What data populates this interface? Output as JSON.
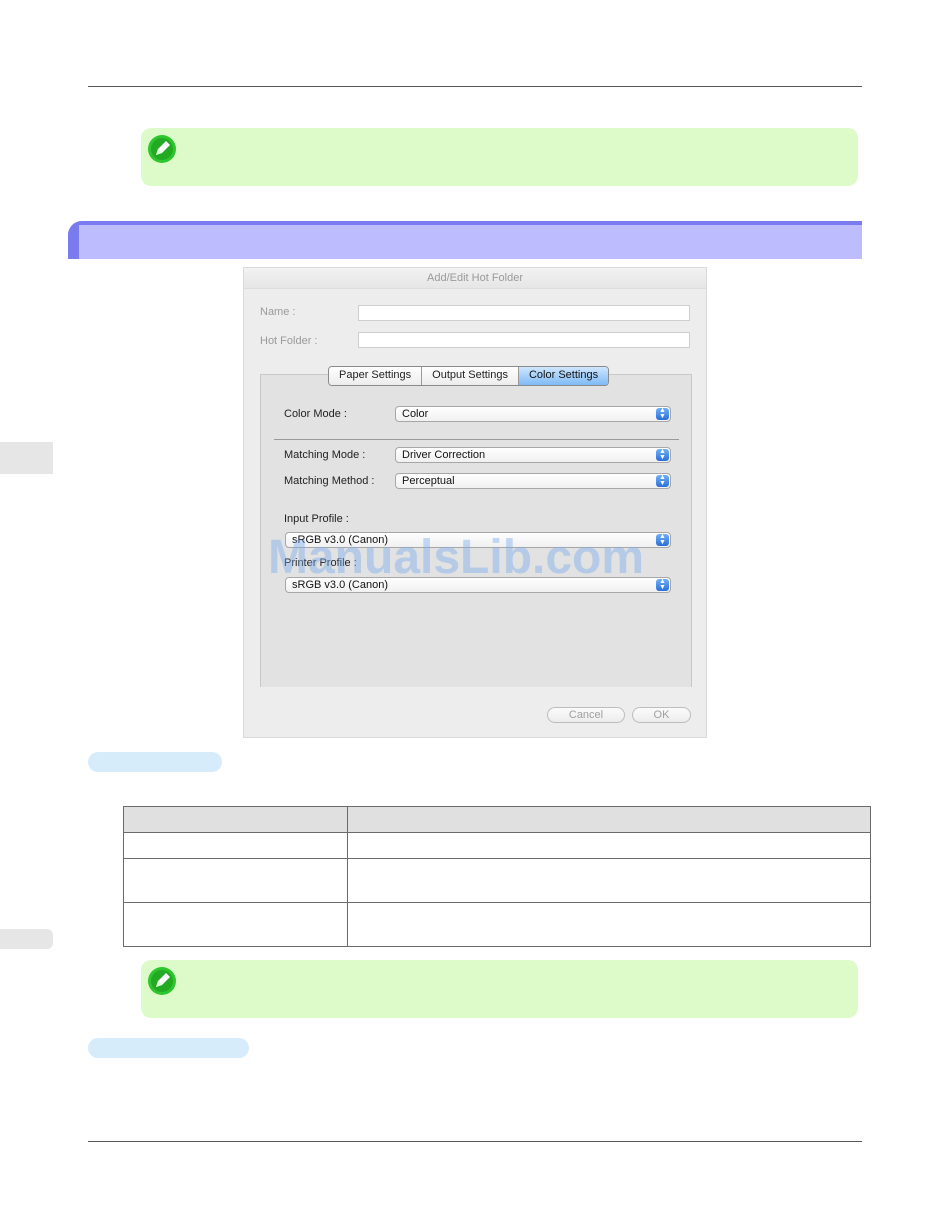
{
  "dialog": {
    "title": "Add/Edit Hot Folder",
    "name_label": "Name :",
    "name_value": "",
    "hot_folder_label": "Hot Folder :",
    "hot_folder_value": "",
    "tabs": [
      {
        "label": "Paper Settings",
        "active": false
      },
      {
        "label": "Output Settings",
        "active": false
      },
      {
        "label": "Color Settings",
        "active": true
      }
    ],
    "color_mode_label": "Color Mode :",
    "color_mode_value": "Color",
    "matching_mode_label": "Matching Mode :",
    "matching_mode_value": "Driver Correction",
    "matching_method_label": "Matching Method :",
    "matching_method_value": "Perceptual",
    "input_profile_label": "Input Profile :",
    "input_profile_value": "sRGB v3.0 (Canon)",
    "printer_profile_label": "Printer Profile :",
    "printer_profile_value": "sRGB v3.0 (Canon)",
    "cancel_label": "Cancel",
    "ok_label": "OK"
  },
  "watermark": "ManualsLib.com",
  "colors": {
    "note_bg": "#ddfbc8",
    "section_bar": "#bcbcff",
    "section_edge": "#7b7bf0",
    "pill": "#d6ecfb",
    "tab_active": "#7fbaf5"
  },
  "icons": [
    "note-pencil-icon",
    "select-arrows-icon"
  ]
}
